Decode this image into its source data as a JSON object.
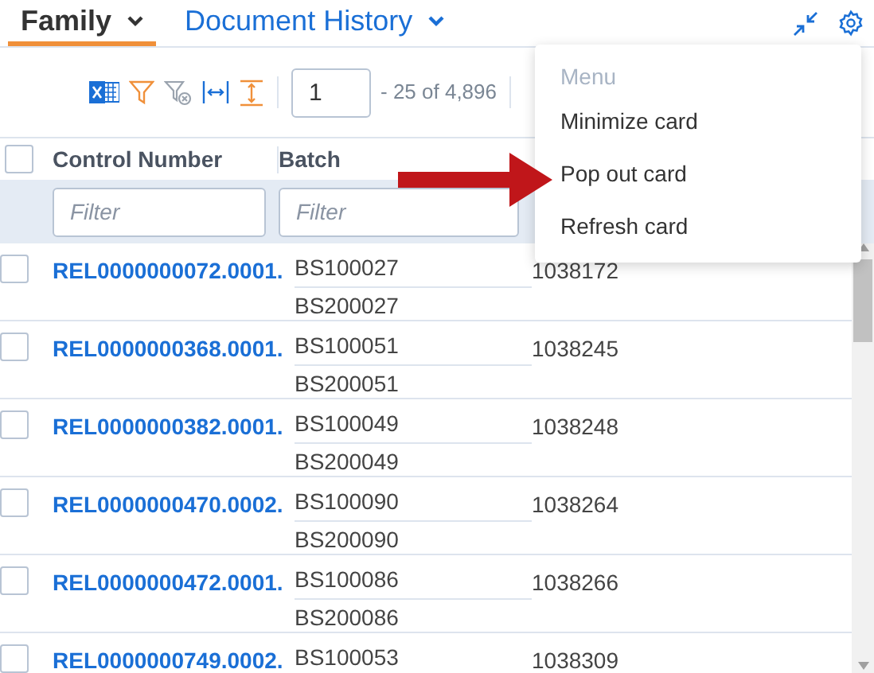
{
  "tabs": [
    {
      "label": "Family",
      "selected": true
    },
    {
      "label": "Document History",
      "selected": false
    }
  ],
  "toolbar": {
    "page_input": {
      "value": "1"
    },
    "page_range": "- 25 of 4,896"
  },
  "table": {
    "select_all": {
      "checked": false
    },
    "columns": [
      "Control Number",
      "Batch"
    ],
    "filters": [
      {
        "placeholder": "Filter"
      },
      {
        "placeholder": "Filter"
      }
    ],
    "rows": [
      {
        "checked": false,
        "control_number": "REL0000000072.0001.",
        "batch": [
          "BS100027",
          "BS200027"
        ],
        "column_3": "1038172"
      },
      {
        "checked": false,
        "control_number": "REL0000000368.0001.",
        "batch": [
          "BS100051",
          "BS200051"
        ],
        "column_3": "1038245"
      },
      {
        "checked": false,
        "control_number": "REL0000000382.0001.",
        "batch": [
          "BS100049",
          "BS200049"
        ],
        "column_3": "1038248"
      },
      {
        "checked": false,
        "control_number": "REL0000000470.0002.",
        "batch": [
          "BS100090",
          "BS200090"
        ],
        "column_3": "1038264"
      },
      {
        "checked": false,
        "control_number": "REL0000000472.0001.",
        "batch": [
          "BS100086",
          "BS200086"
        ],
        "column_3": "1038266"
      },
      {
        "checked": false,
        "control_number": "REL0000000749.0002.",
        "batch": [
          "BS100053"
        ],
        "column_3": "1038309"
      }
    ]
  },
  "menu": {
    "title": "Menu",
    "items": [
      {
        "label": "Minimize card"
      },
      {
        "label": "Pop out card"
      },
      {
        "label": "Refresh card"
      }
    ]
  }
}
